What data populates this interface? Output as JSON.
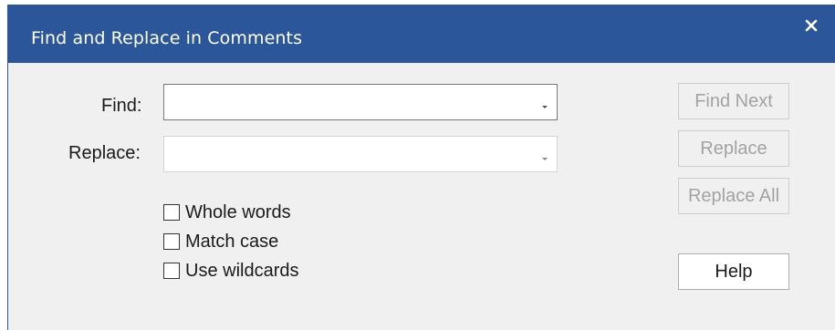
{
  "dialog": {
    "title": "Find and Replace in Comments",
    "close_icon": "close-icon"
  },
  "form": {
    "find_label": "Find:",
    "find_value": "",
    "replace_label": "Replace:",
    "replace_value": "",
    "dropdown_icon": "chevron-down-icon"
  },
  "options": {
    "whole_words": {
      "label": "Whole words",
      "checked": false
    },
    "match_case": {
      "label": "Match case",
      "checked": false
    },
    "use_wildcards": {
      "label": "Use wildcards",
      "checked": false
    }
  },
  "buttons": {
    "find_next": {
      "label": "Find Next",
      "enabled": false
    },
    "replace": {
      "label": "Replace",
      "enabled": false
    },
    "replace_all": {
      "label": "Replace All",
      "enabled": false
    },
    "help": {
      "label": "Help",
      "enabled": true
    }
  },
  "colors": {
    "titlebar": "#2b579a",
    "dialog_bg": "#f0f0f0",
    "disabled_text": "#a3a3a3"
  }
}
